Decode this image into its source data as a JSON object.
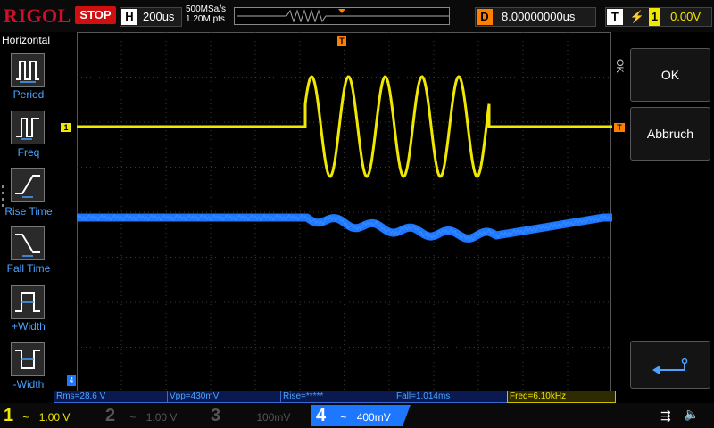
{
  "brand": "RIGOL",
  "run_state": "STOP",
  "horizontal": {
    "key": "H",
    "timebase": "200us",
    "sample_rate": "500MSa/s",
    "points": "1.20M pts"
  },
  "trigger_position": {
    "key": "D",
    "value": "8.00000000us"
  },
  "trigger": {
    "key": "T",
    "source": "1",
    "level": "0.00V"
  },
  "menu": {
    "title": "Horizontal",
    "items": [
      {
        "label": "Period"
      },
      {
        "label": "Freq"
      },
      {
        "label": "Rise Time"
      },
      {
        "label": "Fall Time"
      },
      {
        "label": "+Width"
      },
      {
        "label": "-Width"
      }
    ]
  },
  "right_menu": {
    "ok_label": "OK",
    "ok_side": "OK",
    "cancel_label": "Abbruch"
  },
  "measurements": [
    {
      "text": "Rms=28.6 V"
    },
    {
      "text": "Vpp=430mV"
    },
    {
      "text": "Rise=*****"
    },
    {
      "text": "Fall=1.014ms"
    },
    {
      "text": "Freq=6.10kHz"
    }
  ],
  "channels": [
    {
      "num": "1",
      "coupling": "~",
      "scale": "1.00 V",
      "color": "#f0e800",
      "active": true
    },
    {
      "num": "2",
      "coupling": "~",
      "scale": "1.00 V",
      "color": "#00c8ff",
      "active": false
    },
    {
      "num": "3",
      "coupling": "",
      "scale": "100mV",
      "color": "#ff40ff",
      "active": false
    },
    {
      "num": "4",
      "coupling": "~",
      "scale": "400mV",
      "color": "#2f7fff",
      "active": true
    }
  ],
  "colors": {
    "ch1": "#f0e800",
    "ch4": "#1e78ff",
    "trigger": "#ff7f00",
    "brand": "#d0102a"
  },
  "icons": [
    "period-icon",
    "freq-icon",
    "rise-time-icon",
    "fall-time-icon",
    "pos-width-icon",
    "neg-width-icon",
    "return-icon",
    "usb-icon",
    "speaker-muted-icon"
  ]
}
